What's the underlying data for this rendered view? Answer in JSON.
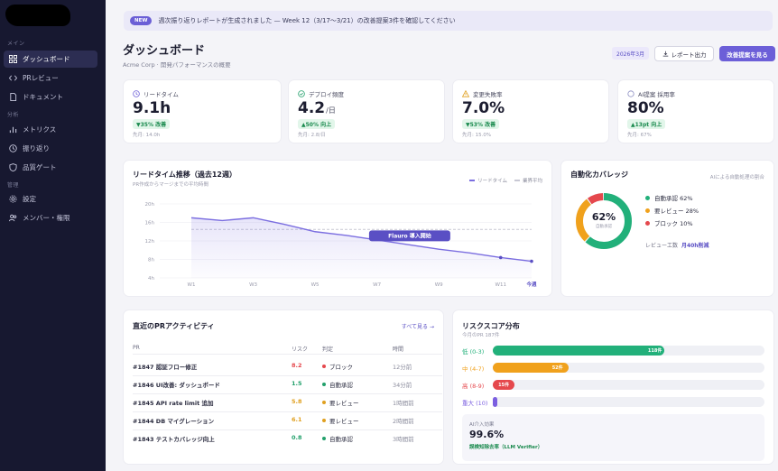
{
  "sidebar": {
    "sections": [
      {
        "title": "メイン"
      },
      {
        "title": "分析"
      },
      {
        "title": "管理"
      }
    ],
    "items": [
      {
        "label": "ダッシュボード",
        "icon": "grid-icon",
        "active": true
      },
      {
        "label": "PRレビュー",
        "icon": "code-icon"
      },
      {
        "label": "ドキュメント",
        "icon": "document-icon"
      },
      {
        "label": "メトリクス",
        "icon": "bar-chart-icon"
      },
      {
        "label": "振り返り",
        "icon": "clock-icon"
      },
      {
        "label": "品質ゲート",
        "icon": "shield-icon"
      },
      {
        "label": "設定",
        "icon": "gear-icon"
      },
      {
        "label": "メンバー・権限",
        "icon": "users-icon"
      }
    ]
  },
  "banner": {
    "badge": "NEW",
    "text": "週次振り返りレポートが生成されました — Week 12（3/17〜3/21）の改善提案3件を確認してください"
  },
  "header": {
    "title": "ダッシュボード",
    "subtitle": "Acme Corp · 開発パフォーマンスの概要",
    "date_pill": "2026年3月",
    "export_label": "レポート出力",
    "primary_label": "改善提案を見る"
  },
  "kpis": [
    {
      "label": "リードタイム",
      "icon": "clock-icon",
      "icon_color": "#6c5fd8",
      "value": "9.1h",
      "unit": "",
      "delta": "▼35% 改善",
      "prev": "先月: 14.0h"
    },
    {
      "label": "デプロイ頻度",
      "icon": "check-circle-icon",
      "icon_color": "#22a06b",
      "value": "4.2",
      "unit": "/日",
      "delta": "▲50% 向上",
      "prev": "先月: 2.8/日"
    },
    {
      "label": "変更失敗率",
      "icon": "warning-icon",
      "icon_color": "#e0a020",
      "value": "7.0%",
      "unit": "",
      "delta": "▼53% 改善",
      "prev": "先月: 15.0%"
    },
    {
      "label": "AI提案 採用率",
      "icon": "circle-icon",
      "icon_color": "#8a8cc0",
      "value": "80%",
      "unit": "",
      "delta": "▲13pt 向上",
      "prev": "先月: 67%"
    }
  ],
  "lead_time_chart": {
    "title": "リードタイム推移（過去12週）",
    "subtitle": "PR作成からマージまでの平均時間",
    "legend": [
      "リードタイム",
      "業界平均"
    ],
    "annotation": "Flauro 導入開始",
    "current_label": "今週"
  },
  "chart_data": {
    "type": "line",
    "title": "リードタイム推移（過去12週）",
    "xlabel": "",
    "ylabel": "",
    "ylim": [
      4,
      20
    ],
    "y_ticks": [
      "20h",
      "16h",
      "12h",
      "8h",
      "4h"
    ],
    "x_ticks": [
      "W1",
      "W3",
      "W5",
      "W7",
      "W9",
      "W11"
    ],
    "x": [
      "W1",
      "W2",
      "W3",
      "W4",
      "W5",
      "W6",
      "W7",
      "W8",
      "W9",
      "W10",
      "W11",
      "W12"
    ],
    "series": [
      {
        "name": "リードタイム",
        "values": [
          17.0,
          16.4,
          17.0,
          15.6,
          14.0,
          13.2,
          12.2,
          11.2,
          10.2,
          9.4,
          8.4,
          7.6
        ]
      },
      {
        "name": "業界平均",
        "values": [
          14.5,
          14.5,
          14.5,
          14.5,
          14.5,
          14.5,
          14.5,
          14.5,
          14.5,
          14.5,
          14.5,
          14.5
        ]
      }
    ],
    "grid": true,
    "legend_position": "top-right",
    "colors": [
      "#7b6ee0",
      "#c8c8d4"
    ]
  },
  "coverage": {
    "title": "自動化カバレッジ",
    "subtitle": "AIによる自動処理の割合",
    "center_value": "62%",
    "center_label": "自動承認",
    "segments": [
      {
        "label": "自動承認 62%",
        "value": 62,
        "color": "#22b07a"
      },
      {
        "label": "要レビュー 28%",
        "value": 28,
        "color": "#f0a11c"
      },
      {
        "label": "ブロック 10%",
        "value": 10,
        "color": "#e5484d"
      }
    ],
    "footer_prefix": "レビュー工数",
    "footer_value": "月40h削減"
  },
  "pr_activity": {
    "title": "直近のPRアクティビティ",
    "link": "すべて見る →",
    "columns": [
      "PR",
      "リスク",
      "判定",
      "時間"
    ],
    "rows": [
      {
        "title": "#1847 認証フロー修正",
        "risk": "8.2",
        "risk_color": "#e5484d",
        "status": "ブロック",
        "status_color": "#e5484d",
        "time": "12分前"
      },
      {
        "title": "#1846 UI改善: ダッシュボード",
        "risk": "1.5",
        "risk_color": "#22a06b",
        "status": "自動承認",
        "status_color": "#22a06b",
        "time": "34分前"
      },
      {
        "title": "#1845 API rate limit 追加",
        "risk": "5.8",
        "risk_color": "#e0a020",
        "status": "要レビュー",
        "status_color": "#e0a020",
        "time": "1時間前"
      },
      {
        "title": "#1844 DB マイグレーション",
        "risk": "6.1",
        "risk_color": "#e0a020",
        "status": "要レビュー",
        "status_color": "#e0a020",
        "time": "2時間前"
      },
      {
        "title": "#1843 テストカバレッジ向上",
        "risk": "0.8",
        "risk_color": "#22a06b",
        "status": "自動承認",
        "status_color": "#22a06b",
        "time": "3時間前"
      }
    ]
  },
  "risk": {
    "title": "リスクスコア分布",
    "subtitle": "今月のPR 187件",
    "bars": [
      {
        "label": "低 (0-3)",
        "count": "118件",
        "value": 118,
        "color": "#22b07a"
      },
      {
        "label": "中 (4-7)",
        "count": "52件",
        "value": 52,
        "color": "#f0a11c"
      },
      {
        "label": "高 (8-9)",
        "count": "15件",
        "value": 15,
        "color": "#e5484d"
      },
      {
        "label": "重大 (10)",
        "count": "",
        "value": 2,
        "color": "#7b5fe0"
      }
    ],
    "max": 187,
    "ai_label": "AI介入効果",
    "ai_value": "99.6%",
    "ai_desc": "誤検知除去率（LLM Verifier）"
  }
}
